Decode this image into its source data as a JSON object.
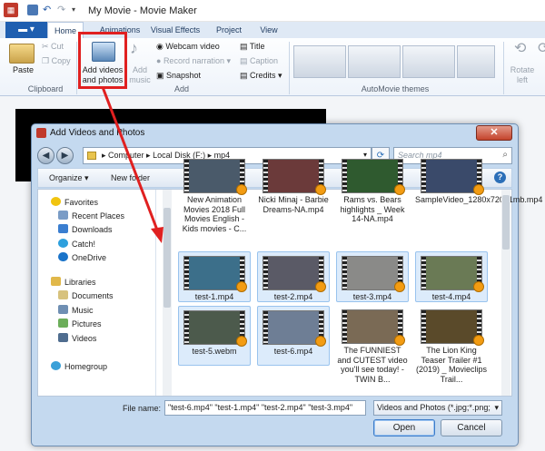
{
  "window": {
    "title": "My Movie - Movie Maker"
  },
  "ribbon_tabs": [
    "Home",
    "Animations",
    "Visual Effects",
    "Project",
    "View"
  ],
  "ribbon": {
    "paste": "Paste",
    "cut": "Cut",
    "copy": "Copy",
    "clipboard_group": "Clipboard",
    "add_videos": "Add videos and photos",
    "add_music": "Add music",
    "webcam": "Webcam video",
    "record_narration": "Record narration",
    "snapshot": "Snapshot",
    "title": "Title",
    "caption": "Caption",
    "credits": "Credits",
    "add_group": "Add",
    "automovie_group": "AutoMovie themes",
    "rotate_left": "Rotate left"
  },
  "dialog": {
    "title": "Add Videos and Photos",
    "close": "✕",
    "breadcrumb": [
      "Computer",
      "Local Disk (F:)",
      "mp4"
    ],
    "search_placeholder": "Search mp4",
    "organize": "Organize ▾",
    "new_folder": "New folder",
    "nav": {
      "favorites": "Favorites",
      "favorite_items": [
        "Recent Places",
        "Downloads",
        "Catch!",
        "OneDrive"
      ],
      "libraries": "Libraries",
      "library_items": [
        "Documents",
        "Music",
        "Pictures",
        "Videos"
      ],
      "homegroup": "Homegroup"
    },
    "files": [
      {
        "name": "New Animation Movies 2018 Full Movies English - Kids movies - C..."
      },
      {
        "name": "Nicki Minaj - Barbie Dreams-NA.mp4"
      },
      {
        "name": "Rams vs. Bears highlights _ Week 14-NA.mp4"
      },
      {
        "name": "SampleVideo_1280x720_1mb.mp4"
      },
      {
        "name": "test-1.mp4",
        "selected": true
      },
      {
        "name": "test-2.mp4",
        "selected": true
      },
      {
        "name": "test-3.mp4",
        "selected": true
      },
      {
        "name": "test-4.mp4",
        "selected": true
      },
      {
        "name": "test-5.webm",
        "selected": true
      },
      {
        "name": "test-6.mp4",
        "selected": true
      },
      {
        "name": "The FUNNIEST and CUTEST video you'll see today! - TWIN B..."
      },
      {
        "name": "The Lion King Teaser Trailer #1 (2019) _ Movieclips Trail..."
      }
    ],
    "file_name_label": "File name:",
    "file_name_value": "\"test-6.mp4\" \"test-1.mp4\" \"test-2.mp4\" \"test-3.mp4\"",
    "file_type_value": "Videos and Photos (*.jpg;*.png;",
    "open": "Open",
    "cancel": "Cancel"
  },
  "colors": {
    "accent": "#1f5fb0",
    "highlight_box": "#e02020",
    "selection": "#dcebfb"
  }
}
